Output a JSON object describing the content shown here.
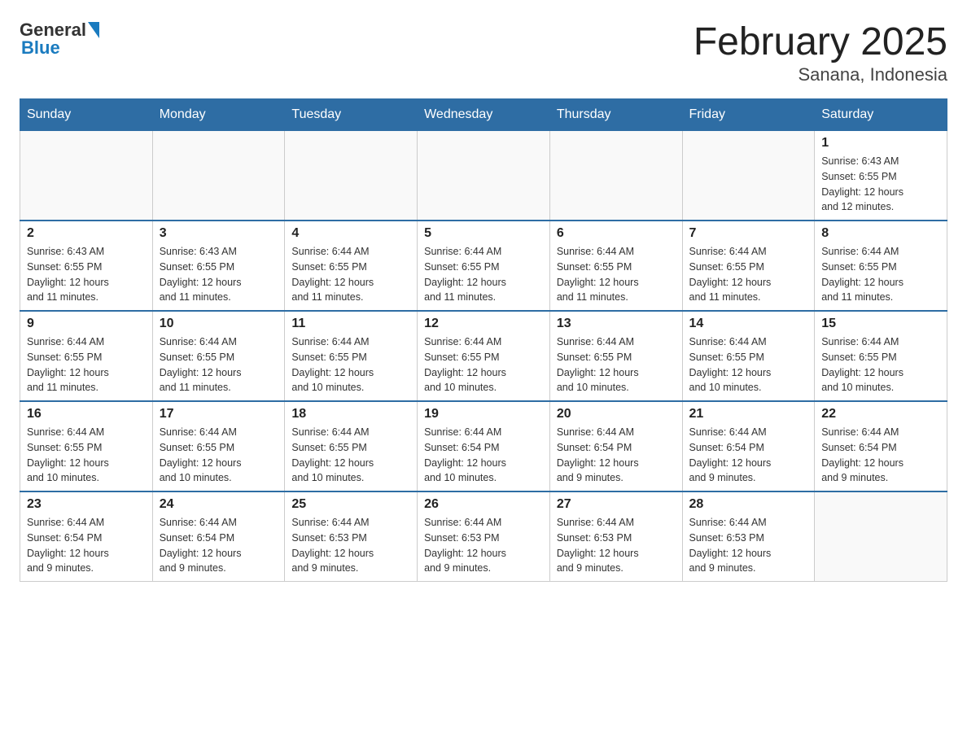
{
  "header": {
    "logo_general": "General",
    "logo_blue": "Blue",
    "title": "February 2025",
    "subtitle": "Sanana, Indonesia"
  },
  "weekdays": [
    "Sunday",
    "Monday",
    "Tuesday",
    "Wednesday",
    "Thursday",
    "Friday",
    "Saturday"
  ],
  "weeks": [
    [
      {
        "day": "",
        "info": ""
      },
      {
        "day": "",
        "info": ""
      },
      {
        "day": "",
        "info": ""
      },
      {
        "day": "",
        "info": ""
      },
      {
        "day": "",
        "info": ""
      },
      {
        "day": "",
        "info": ""
      },
      {
        "day": "1",
        "info": "Sunrise: 6:43 AM\nSunset: 6:55 PM\nDaylight: 12 hours\nand 12 minutes."
      }
    ],
    [
      {
        "day": "2",
        "info": "Sunrise: 6:43 AM\nSunset: 6:55 PM\nDaylight: 12 hours\nand 11 minutes."
      },
      {
        "day": "3",
        "info": "Sunrise: 6:43 AM\nSunset: 6:55 PM\nDaylight: 12 hours\nand 11 minutes."
      },
      {
        "day": "4",
        "info": "Sunrise: 6:44 AM\nSunset: 6:55 PM\nDaylight: 12 hours\nand 11 minutes."
      },
      {
        "day": "5",
        "info": "Sunrise: 6:44 AM\nSunset: 6:55 PM\nDaylight: 12 hours\nand 11 minutes."
      },
      {
        "day": "6",
        "info": "Sunrise: 6:44 AM\nSunset: 6:55 PM\nDaylight: 12 hours\nand 11 minutes."
      },
      {
        "day": "7",
        "info": "Sunrise: 6:44 AM\nSunset: 6:55 PM\nDaylight: 12 hours\nand 11 minutes."
      },
      {
        "day": "8",
        "info": "Sunrise: 6:44 AM\nSunset: 6:55 PM\nDaylight: 12 hours\nand 11 minutes."
      }
    ],
    [
      {
        "day": "9",
        "info": "Sunrise: 6:44 AM\nSunset: 6:55 PM\nDaylight: 12 hours\nand 11 minutes."
      },
      {
        "day": "10",
        "info": "Sunrise: 6:44 AM\nSunset: 6:55 PM\nDaylight: 12 hours\nand 11 minutes."
      },
      {
        "day": "11",
        "info": "Sunrise: 6:44 AM\nSunset: 6:55 PM\nDaylight: 12 hours\nand 10 minutes."
      },
      {
        "day": "12",
        "info": "Sunrise: 6:44 AM\nSunset: 6:55 PM\nDaylight: 12 hours\nand 10 minutes."
      },
      {
        "day": "13",
        "info": "Sunrise: 6:44 AM\nSunset: 6:55 PM\nDaylight: 12 hours\nand 10 minutes."
      },
      {
        "day": "14",
        "info": "Sunrise: 6:44 AM\nSunset: 6:55 PM\nDaylight: 12 hours\nand 10 minutes."
      },
      {
        "day": "15",
        "info": "Sunrise: 6:44 AM\nSunset: 6:55 PM\nDaylight: 12 hours\nand 10 minutes."
      }
    ],
    [
      {
        "day": "16",
        "info": "Sunrise: 6:44 AM\nSunset: 6:55 PM\nDaylight: 12 hours\nand 10 minutes."
      },
      {
        "day": "17",
        "info": "Sunrise: 6:44 AM\nSunset: 6:55 PM\nDaylight: 12 hours\nand 10 minutes."
      },
      {
        "day": "18",
        "info": "Sunrise: 6:44 AM\nSunset: 6:55 PM\nDaylight: 12 hours\nand 10 minutes."
      },
      {
        "day": "19",
        "info": "Sunrise: 6:44 AM\nSunset: 6:54 PM\nDaylight: 12 hours\nand 10 minutes."
      },
      {
        "day": "20",
        "info": "Sunrise: 6:44 AM\nSunset: 6:54 PM\nDaylight: 12 hours\nand 9 minutes."
      },
      {
        "day": "21",
        "info": "Sunrise: 6:44 AM\nSunset: 6:54 PM\nDaylight: 12 hours\nand 9 minutes."
      },
      {
        "day": "22",
        "info": "Sunrise: 6:44 AM\nSunset: 6:54 PM\nDaylight: 12 hours\nand 9 minutes."
      }
    ],
    [
      {
        "day": "23",
        "info": "Sunrise: 6:44 AM\nSunset: 6:54 PM\nDaylight: 12 hours\nand 9 minutes."
      },
      {
        "day": "24",
        "info": "Sunrise: 6:44 AM\nSunset: 6:54 PM\nDaylight: 12 hours\nand 9 minutes."
      },
      {
        "day": "25",
        "info": "Sunrise: 6:44 AM\nSunset: 6:53 PM\nDaylight: 12 hours\nand 9 minutes."
      },
      {
        "day": "26",
        "info": "Sunrise: 6:44 AM\nSunset: 6:53 PM\nDaylight: 12 hours\nand 9 minutes."
      },
      {
        "day": "27",
        "info": "Sunrise: 6:44 AM\nSunset: 6:53 PM\nDaylight: 12 hours\nand 9 minutes."
      },
      {
        "day": "28",
        "info": "Sunrise: 6:44 AM\nSunset: 6:53 PM\nDaylight: 12 hours\nand 9 minutes."
      },
      {
        "day": "",
        "info": ""
      }
    ]
  ]
}
